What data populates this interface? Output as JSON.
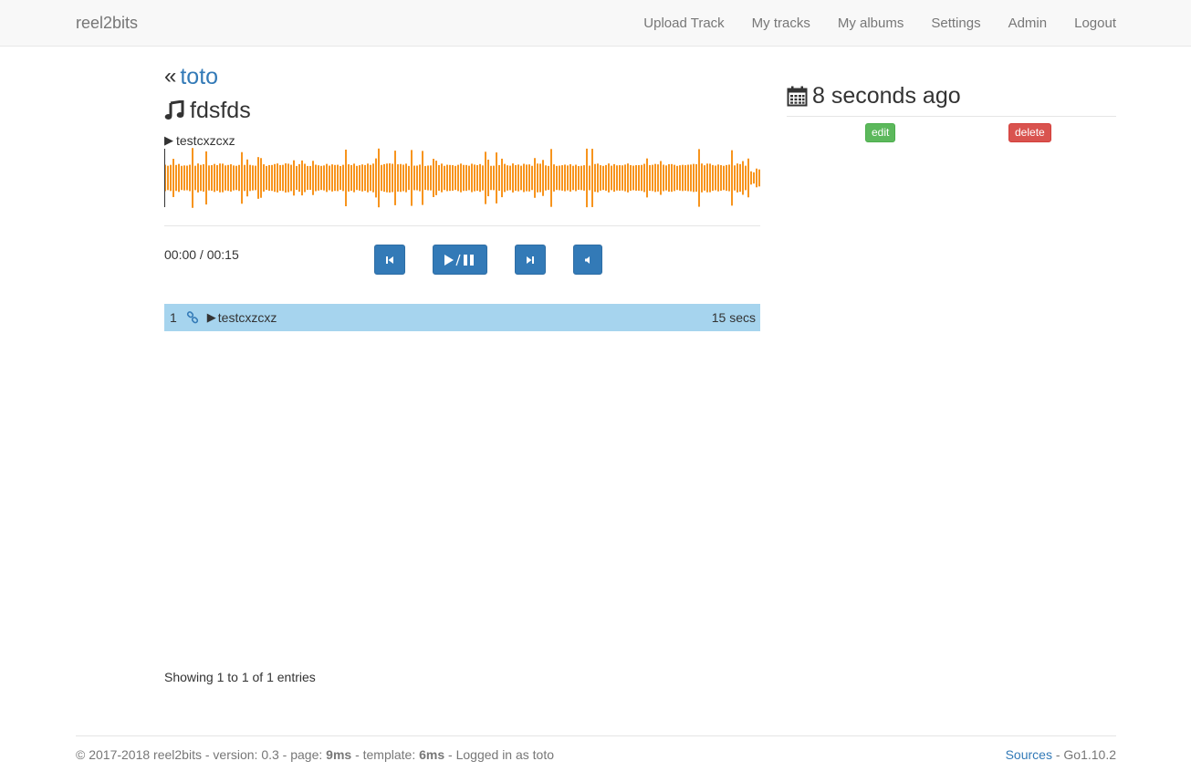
{
  "navbar": {
    "brand": "reel2bits",
    "links": [
      "Upload Track",
      "My tracks",
      "My albums",
      "Settings",
      "Admin",
      "Logout"
    ]
  },
  "album": {
    "owner": "toto",
    "title": "fdsfds",
    "back_icon": "double-chevron-left-icon",
    "title_icon": "music-note-icon"
  },
  "player": {
    "now_playing": "testcxzcxz",
    "time": "00:00 / 00:15",
    "waveform_color": "#f7941d",
    "controls": [
      "previous-icon",
      "play-pause-icon",
      "next-icon",
      "volume-icon"
    ]
  },
  "tracks": [
    {
      "number": "1",
      "title": "testcxzcxz",
      "duration": "15 secs"
    }
  ],
  "table_info": "Showing 1 to 1 of 1 entries",
  "sidebar": {
    "uploaded": "8 seconds ago",
    "edit_label": "edit",
    "delete_label": "delete"
  },
  "footer": {
    "prefix": "© 2017-2018 reel2bits - version: 0.3 - page: ",
    "page_time": "9ms",
    "middle": " - template: ",
    "template_time": "6ms",
    "suffix": " - Logged in as toto",
    "sources_label": "Sources",
    "go_version": " - Go1.10.2"
  },
  "colors": {
    "accent": "#337ab7",
    "success": "#5cb85c",
    "danger": "#d9534f",
    "row_highlight": "#a6d4ee"
  }
}
